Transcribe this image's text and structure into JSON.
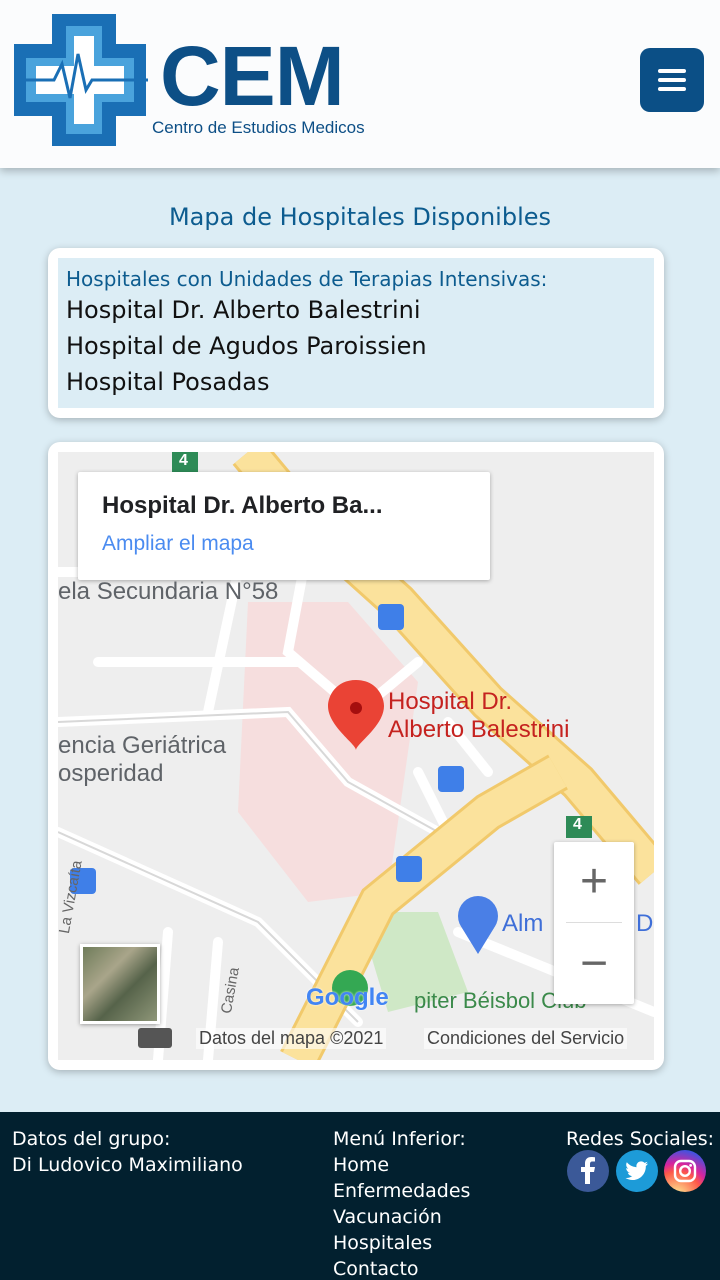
{
  "header": {
    "logo_text": "CEM",
    "logo_subtitle": "Centro de Estudios Medicos",
    "menu_icon": "hamburger-icon"
  },
  "page": {
    "title": "Mapa de Hospitales Disponibles"
  },
  "hospital_list": {
    "heading": "Hospitales con Unidades de Terapias Intensivas:",
    "items": [
      "Hospital Dr. Alberto Balestrini",
      "Hospital de Agudos Paroissien",
      "Hospital Posadas"
    ]
  },
  "map": {
    "info_title": "Hospital Dr. Alberto Ba...",
    "info_link": "Ampliar el mapa",
    "marker_label_line1": "Hospital Dr.",
    "marker_label_line2": "Alberto Balestrini",
    "street_label": "ela Secundaria N°58",
    "place_label_1": "encia Geriátrica",
    "place_label_2": "osperidad",
    "store_label_a": "Alm",
    "store_label_b": "D",
    "club_label": "piter Béisbol Club",
    "road_number_top": "4",
    "road_number_right": "4",
    "street_vertical_1": "La Vizcaíta",
    "street_vertical_2": "Casina",
    "google_logo": "Google",
    "attribution": "Datos del mapa ©2021",
    "terms": "Condiciones del Servicio",
    "zoom_in": "+",
    "zoom_out": "−",
    "colors": {
      "road_main": "#fbe29c",
      "hospital_area": "#f6dede",
      "park": "#cfe8c6",
      "marker": "#ea4335",
      "label_red": "#c5221f"
    }
  },
  "footer": {
    "group": {
      "heading": "Datos del grupo:",
      "member": "Di Ludovico Maximiliano"
    },
    "menu": {
      "heading": "Menú Inferior:",
      "links": [
        "Home",
        "Enfermedades",
        "Vacunación",
        "Hospitales",
        "Contacto"
      ]
    },
    "social": {
      "heading": "Redes Sociales:",
      "icons": [
        "facebook-icon",
        "twitter-icon",
        "instagram-icon"
      ]
    }
  }
}
